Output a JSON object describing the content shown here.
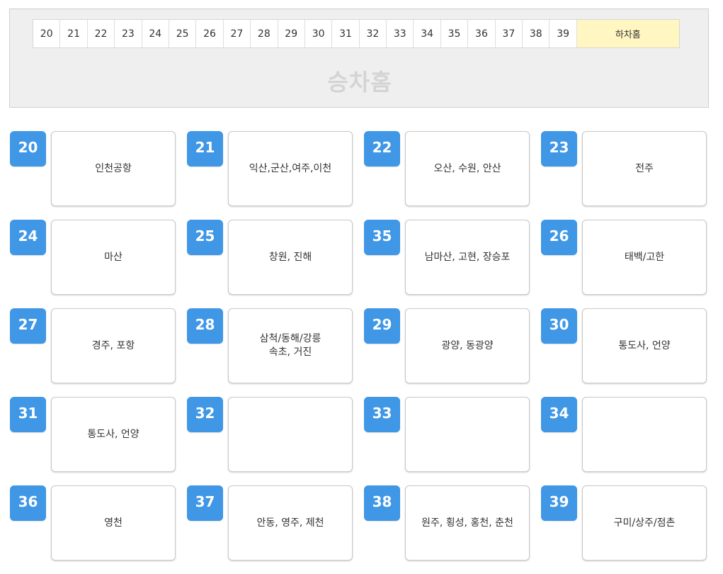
{
  "header": {
    "platforms": [
      "20",
      "21",
      "22",
      "23",
      "24",
      "25",
      "26",
      "27",
      "28",
      "29",
      "30",
      "31",
      "32",
      "33",
      "34",
      "35",
      "36",
      "37",
      "38",
      "39"
    ],
    "drop_off_label": "하차홈",
    "boarding_label": "승차홈"
  },
  "gates": [
    {
      "number": "20",
      "destination": "인천공항"
    },
    {
      "number": "21",
      "destination": "익산,군산,여주,이천"
    },
    {
      "number": "22",
      "destination": "오산, 수원, 안산"
    },
    {
      "number": "23",
      "destination": "전주"
    },
    {
      "number": "24",
      "destination": "마산"
    },
    {
      "number": "25",
      "destination": "창원, 진해"
    },
    {
      "number": "35",
      "destination": "남마산, 고현, 장승포"
    },
    {
      "number": "26",
      "destination": "태백/고한"
    },
    {
      "number": "27",
      "destination": "경주, 포항"
    },
    {
      "number": "28",
      "destination": "삼척/동해/강릉\n속초, 거진"
    },
    {
      "number": "29",
      "destination": "광양, 동광양"
    },
    {
      "number": "30",
      "destination": "통도사, 언양"
    },
    {
      "number": "31",
      "destination": "통도사, 언양"
    },
    {
      "number": "32",
      "destination": ""
    },
    {
      "number": "33",
      "destination": ""
    },
    {
      "number": "34",
      "destination": ""
    },
    {
      "number": "36",
      "destination": "영천"
    },
    {
      "number": "37",
      "destination": "안동, 영주, 제천"
    },
    {
      "number": "38",
      "destination": "원주, 횡성, 홍천, 춘천"
    },
    {
      "number": "39",
      "destination": "구미/상주/점촌"
    }
  ],
  "colors": {
    "badge": "#3f97e6",
    "drop_off_bg": "#fff6c2",
    "header_bg": "#efefef"
  }
}
